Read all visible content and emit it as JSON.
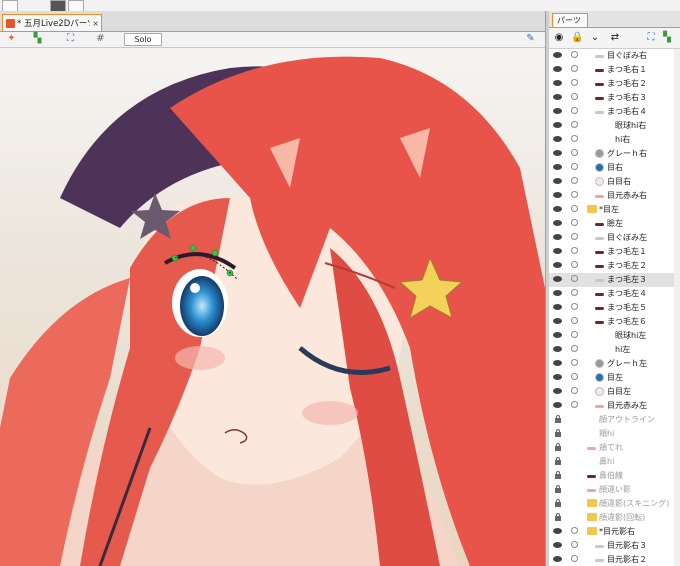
{
  "document_tab": {
    "title": "* 五月Live2Dパーツ分け",
    "close": "×"
  },
  "toolbar": {
    "solo_label": "Solo"
  },
  "parts_panel": {
    "tab_label": "パーツ",
    "items": [
      {
        "label": "目ぐぼみ右",
        "indent": 1,
        "thumb": "line",
        "state": "visible"
      },
      {
        "label": "まつ毛右１",
        "indent": 1,
        "thumb": "lash",
        "state": "visible"
      },
      {
        "label": "まつ毛右２",
        "indent": 1,
        "thumb": "lash",
        "state": "visible"
      },
      {
        "label": "まつ毛右３",
        "indent": 1,
        "thumb": "lash",
        "state": "visible"
      },
      {
        "label": "まつ毛右４",
        "indent": 1,
        "thumb": "line",
        "state": "visible"
      },
      {
        "label": "眼球hi右",
        "indent": 2,
        "thumb": "none",
        "state": "visible"
      },
      {
        "label": "hi右",
        "indent": 2,
        "thumb": "none",
        "state": "visible"
      },
      {
        "label": "グレーｈ右",
        "indent": 1,
        "thumb": "gray",
        "state": "visible"
      },
      {
        "label": "目右",
        "indent": 1,
        "thumb": "eye",
        "state": "visible"
      },
      {
        "label": "白目右",
        "indent": 1,
        "thumb": "white",
        "state": "visible"
      },
      {
        "label": "目元赤み右",
        "indent": 1,
        "thumb": "pink",
        "state": "visible"
      },
      {
        "label": "*目左",
        "indent": 0,
        "thumb": "folder",
        "state": "visible"
      },
      {
        "label": "瞼左",
        "indent": 1,
        "thumb": "lash",
        "state": "visible"
      },
      {
        "label": "目ぐぼみ左",
        "indent": 1,
        "thumb": "line",
        "state": "visible"
      },
      {
        "label": "まつ毛左１",
        "indent": 1,
        "thumb": "lash",
        "state": "visible"
      },
      {
        "label": "まつ毛左２",
        "indent": 1,
        "thumb": "lash",
        "state": "visible"
      },
      {
        "label": "まつ毛左３",
        "indent": 1,
        "thumb": "line",
        "state": "selected"
      },
      {
        "label": "まつ毛左４",
        "indent": 1,
        "thumb": "lash",
        "state": "visible"
      },
      {
        "label": "まつ毛左５",
        "indent": 1,
        "thumb": "lash",
        "state": "visible"
      },
      {
        "label": "まつ毛左６",
        "indent": 1,
        "thumb": "lash",
        "state": "visible"
      },
      {
        "label": "眼球hi左",
        "indent": 2,
        "thumb": "none",
        "state": "visible"
      },
      {
        "label": "hi左",
        "indent": 2,
        "thumb": "none",
        "state": "visible"
      },
      {
        "label": "グレーｈ左",
        "indent": 1,
        "thumb": "gray",
        "state": "visible"
      },
      {
        "label": "目左",
        "indent": 1,
        "thumb": "eye",
        "state": "visible"
      },
      {
        "label": "白目左",
        "indent": 1,
        "thumb": "white",
        "state": "visible"
      },
      {
        "label": "目元赤み左",
        "indent": 1,
        "thumb": "pink",
        "state": "visible"
      },
      {
        "label": "顔アウトライン",
        "indent": 0,
        "thumb": "none",
        "state": "locked"
      },
      {
        "label": "頬hi",
        "indent": 0,
        "thumb": "none",
        "state": "locked"
      },
      {
        "label": "頬てれ",
        "indent": 0,
        "thumb": "pink",
        "state": "locked"
      },
      {
        "label": "鼻hi",
        "indent": 0,
        "thumb": "none",
        "state": "locked"
      },
      {
        "label": "鼻伯線",
        "indent": 0,
        "thumb": "lash",
        "state": "locked"
      },
      {
        "label": "顔違い影",
        "indent": 0,
        "thumb": "pink",
        "state": "locked"
      },
      {
        "label": "顔違影(スキニング)",
        "indent": 0,
        "thumb": "folder",
        "state": "locked"
      },
      {
        "label": "顔違影(回転)",
        "indent": 0,
        "thumb": "folder",
        "state": "locked"
      },
      {
        "label": "*目元影右",
        "indent": 0,
        "thumb": "folder",
        "state": "visible"
      },
      {
        "label": "目元影右３",
        "indent": 1,
        "thumb": "line",
        "state": "visible"
      },
      {
        "label": "目元影右２",
        "indent": 1,
        "thumb": "line",
        "state": "visible"
      }
    ]
  },
  "colors": {
    "accent": "#f08b2c",
    "hair": "#e8544a",
    "eye": "#2c8fd0",
    "skin": "#f9e4d8"
  }
}
